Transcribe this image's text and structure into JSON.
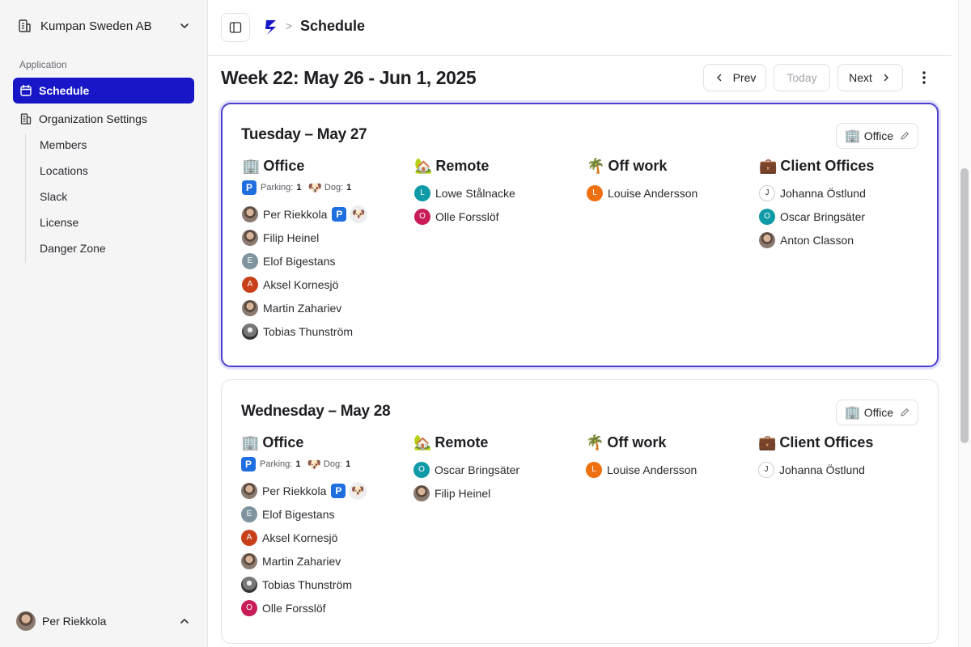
{
  "sidebar": {
    "org_name": "Kumpan Sweden AB",
    "section_label": "Application",
    "nav": [
      {
        "label": "Schedule",
        "icon": "calendar-icon",
        "active": true
      },
      {
        "label": "Organization Settings",
        "icon": "building-icon",
        "active": false
      }
    ],
    "sub_items": [
      "Members",
      "Locations",
      "Slack",
      "License",
      "Danger Zone"
    ],
    "user_name": "Per Riekkola"
  },
  "header": {
    "breadcrumb_separator": ">",
    "title": "Schedule"
  },
  "week": {
    "title": "Week 22: May 26 - Jun 1, 2025",
    "prev_label": "Prev",
    "today_label": "Today",
    "next_label": "Next"
  },
  "days": [
    {
      "title": "Tuesday – May 27",
      "location_button": {
        "emoji": "🏢",
        "label": "Office"
      },
      "columns": [
        {
          "emoji": "🏢",
          "title": "Office",
          "parking_label": "Parking:",
          "parking_count": "1",
          "dog_label": "Dog:",
          "dog_count": "1",
          "people": [
            {
              "name": "Per Riekkola",
              "avatar": "photo",
              "parking": true,
              "dog": true
            },
            {
              "name": "Filip Heinel",
              "avatar": "photo"
            },
            {
              "name": "Elof Bigestans",
              "initial": "E",
              "color": "#7f949e"
            },
            {
              "name": "Aksel Kornesjö",
              "initial": "A",
              "color": "#c8401a"
            },
            {
              "name": "Martin Zahariev",
              "avatar": "photo"
            },
            {
              "name": "Tobias Thunström",
              "avatar": "photo2"
            }
          ]
        },
        {
          "emoji": "🏡",
          "title": "Remote",
          "people": [
            {
              "name": "Lowe Stålnacke",
              "initial": "L",
              "color": "#0f9aa8"
            },
            {
              "name": "Olle Forsslöf",
              "initial": "O",
              "color": "#c81d59"
            }
          ]
        },
        {
          "emoji": "🌴",
          "title": "Off work",
          "people": [
            {
              "name": "Louise Andersson",
              "initial": "L",
              "color": "#ee7010"
            }
          ]
        },
        {
          "emoji": "💼",
          "title": "Client Offices",
          "people": [
            {
              "name": "Johanna Östlund",
              "initial": "J",
              "color": "outline"
            },
            {
              "name": "Oscar Bringsäter",
              "initial": "O",
              "color": "#0f9aa8"
            },
            {
              "name": "Anton Classon",
              "avatar": "photo"
            }
          ]
        }
      ]
    },
    {
      "title": "Wednesday – May 28",
      "location_button": {
        "emoji": "🏢",
        "label": "Office"
      },
      "columns": [
        {
          "emoji": "🏢",
          "title": "Office",
          "parking_label": "Parking:",
          "parking_count": "1",
          "dog_label": "Dog:",
          "dog_count": "1",
          "people": [
            {
              "name": "Per Riekkola",
              "avatar": "photo",
              "parking": true,
              "dog": true
            },
            {
              "name": "Elof Bigestans",
              "initial": "E",
              "color": "#7f949e"
            },
            {
              "name": "Aksel Kornesjö",
              "initial": "A",
              "color": "#c8401a"
            },
            {
              "name": "Martin Zahariev",
              "avatar": "photo"
            },
            {
              "name": "Tobias Thunström",
              "avatar": "photo2"
            },
            {
              "name": "Olle Forsslöf",
              "initial": "O",
              "color": "#c81d59"
            }
          ]
        },
        {
          "emoji": "🏡",
          "title": "Remote",
          "people": [
            {
              "name": "Oscar Bringsäter",
              "initial": "O",
              "color": "#0f9aa8"
            },
            {
              "name": "Filip Heinel",
              "avatar": "photo"
            }
          ]
        },
        {
          "emoji": "🌴",
          "title": "Off work",
          "people": [
            {
              "name": "Louise Andersson",
              "initial": "L",
              "color": "#ee7010"
            }
          ]
        },
        {
          "emoji": "💼",
          "title": "Client Offices",
          "people": [
            {
              "name": "Johanna Östlund",
              "initial": "J",
              "color": "outline"
            }
          ]
        }
      ]
    }
  ],
  "colors": {
    "accent": "#1717c7",
    "selected_border": "#4b3fd1",
    "parking": "#1f6fe0"
  }
}
